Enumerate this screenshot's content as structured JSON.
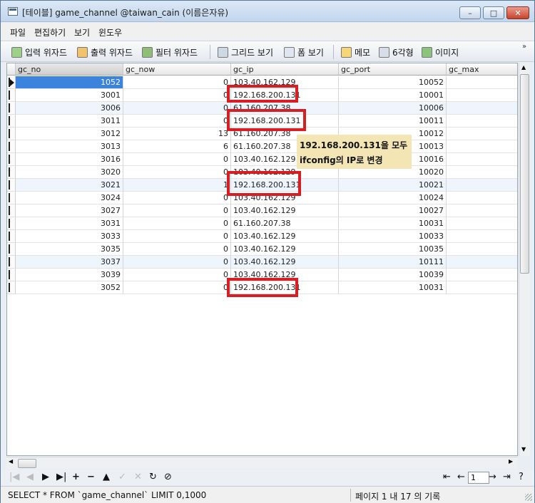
{
  "window": {
    "title": "[테이블] game_channel @taiwan_cain (이름은자유)",
    "minimize": "–",
    "maximize": "□",
    "close": "✕"
  },
  "menu": [
    "파일",
    "편집하기",
    "보기",
    "윈도우"
  ],
  "toolbar": {
    "import": "입력 위자드",
    "export": "출력 위자드",
    "filter": "필터 위자드",
    "grid_view": "그리드 보기",
    "form_view": "폼 보기",
    "memo": "메모",
    "hex": "6각형",
    "image": "이미지",
    "more": "»"
  },
  "columns": [
    "gc_no",
    "gc_now",
    "gc_ip",
    "gc_port",
    "gc_max"
  ],
  "rows": [
    [
      "1052",
      "0",
      "103.40.162.129",
      "10052",
      ""
    ],
    [
      "3001",
      "0",
      "192.168.200.131",
      "10001",
      ""
    ],
    [
      "3006",
      "0",
      "61.160.207.38",
      "10006",
      ""
    ],
    [
      "3011",
      "0",
      "192.168.200.131",
      "10011",
      ""
    ],
    [
      "3012",
      "13",
      "61.160.207.38",
      "10012",
      ""
    ],
    [
      "3013",
      "6",
      "61.160.207.38",
      "10013",
      ""
    ],
    [
      "3016",
      "0",
      "103.40.162.129",
      "10016",
      ""
    ],
    [
      "3020",
      "0",
      "103.40.162.129",
      "10020",
      ""
    ],
    [
      "3021",
      "1",
      "192.168.200.131",
      "10021",
      ""
    ],
    [
      "3024",
      "0",
      "103.40.162.129",
      "10024",
      ""
    ],
    [
      "3027",
      "0",
      "103.40.162.129",
      "10027",
      ""
    ],
    [
      "3031",
      "0",
      "61.160.207.38",
      "10031",
      ""
    ],
    [
      "3033",
      "0",
      "103.40.162.129",
      "10033",
      ""
    ],
    [
      "3035",
      "0",
      "103.40.162.129",
      "10035",
      ""
    ],
    [
      "3037",
      "0",
      "103.40.162.129",
      "10111",
      ""
    ],
    [
      "3039",
      "0",
      "103.40.162.129",
      "10039",
      ""
    ],
    [
      "3052",
      "0",
      "192.168.200.131",
      "10031",
      ""
    ]
  ],
  "annotation": {
    "line1": "192.168.200.131을 모두",
    "line2": "ifconfig의 IP로 변경"
  },
  "nav": {
    "page": "1",
    "first": "⇤",
    "prev": "←",
    "next": "→",
    "last": "⇥",
    "more": "?"
  },
  "status": {
    "sql": "SELECT * FROM `game_channel` LIMIT 0,1000",
    "info": "페이지 1 내 17 의 기록"
  },
  "colors": {
    "highlight": "#d81e22",
    "note_bg": "#f3e5b4",
    "selected_cell": "#3b83dd"
  }
}
